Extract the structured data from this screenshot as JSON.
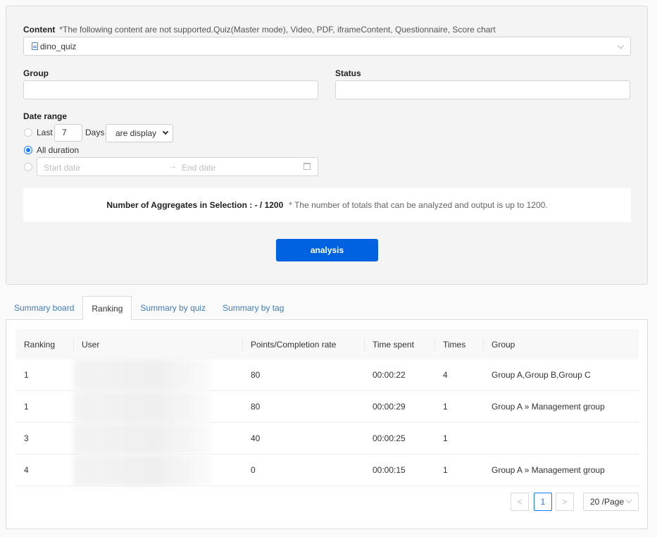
{
  "filters": {
    "content": {
      "label": "Content",
      "note": "*The following content are not supported.Quiz(Master mode), Video, PDF, iframeContent, Questionnaire, Score chart",
      "selected": "dino_quiz",
      "icon": "file-icon"
    },
    "group": {
      "label": "Group",
      "value": ""
    },
    "status": {
      "label": "Status",
      "value": ""
    },
    "date_range": {
      "label": "Date range",
      "last_label": "Last",
      "last_days_value": "7",
      "days_label": "Days",
      "display_option": "are display",
      "all_duration_label": "All duration",
      "selected": "all_duration",
      "start_placeholder": "Start date",
      "arrow": "→",
      "end_placeholder": "End date"
    },
    "aggregates": {
      "label": "Number of Aggregates in Selection : - / 1200",
      "note": "* The number of totals that can be analyzed and output is up to 1200."
    },
    "analysis_button": "analysis"
  },
  "tabs": [
    {
      "label": "Summary board",
      "active": false
    },
    {
      "label": "Ranking",
      "active": true
    },
    {
      "label": "Summary by quiz",
      "active": false
    },
    {
      "label": "Summary by tag",
      "active": false
    }
  ],
  "table": {
    "columns": [
      "Ranking",
      "User",
      "Points/Completion rate",
      "Time spent",
      "Times",
      "Group"
    ],
    "rows": [
      {
        "ranking": "1",
        "user": "",
        "points": "80",
        "time": "00:00:22",
        "times": "4",
        "group": "Group A,Group B,Group C"
      },
      {
        "ranking": "1",
        "user": "",
        "points": "80",
        "time": "00:00:29",
        "times": "1",
        "group": "Group A » Management group"
      },
      {
        "ranking": "3",
        "user": "",
        "points": "40",
        "time": "00:00:25",
        "times": "1",
        "group": ""
      },
      {
        "ranking": "4",
        "user": "",
        "points": "0",
        "time": "00:00:15",
        "times": "1",
        "group": "Group A » Management group"
      }
    ]
  },
  "pagination": {
    "prev": "<",
    "current_page": "1",
    "next": ">",
    "page_size": "20 /Page"
  }
}
